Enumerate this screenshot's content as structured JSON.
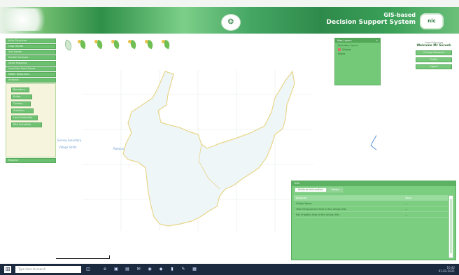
{
  "banner": {
    "title_line1": "GIS-based",
    "title_line2": "Decision Support System",
    "nic_logo": "nic"
  },
  "sidebar": {
    "items": [
      "Infra Structure",
      "Crop Health",
      "Soil Health",
      "Spatial Analysis",
      "Asset Mapping",
      "Land Use Land Cover",
      "Water Resources",
      "Weather",
      "Reports"
    ],
    "active_group": "Analysis",
    "subitems": [
      "Boundary",
      "Buffer",
      "Overlay",
      "Statistics",
      "Land Suitability",
      "Site Suitability"
    ]
  },
  "tools": [
    "leaf-icon",
    "leaf-icon",
    "leaf-icon",
    "leaf-icon",
    "leaf-icon",
    "leaf-icon",
    "leaf-icon"
  ],
  "map": {
    "label_left": "Survey boundary",
    "label_left2": "Village limits",
    "label_center": "Rampur",
    "accent": "#e8d68a",
    "fill": "#eef6f8"
  },
  "legend": {
    "title": "Map Layers",
    "row1": "Boundary Layers",
    "row2": "Villages",
    "row3": "Roads"
  },
  "user": {
    "greeting": "Good Morning",
    "name": "Welcome Mr Suresh",
    "btn1": "Change Password",
    "btn2": "Profile",
    "btn3": "Logout"
  },
  "attribute": {
    "title": "Info",
    "tab_active": "Attribute Information",
    "tab_other": "Details",
    "columns": [
      "Attribute",
      "Value"
    ],
    "rows": [
      [
        "Village Name",
        "—"
      ],
      [
        "Total Geographical Area of the village (Ha)",
        "—"
      ],
      [
        "Net Irrigated Area of the village (Ha)",
        "—"
      ]
    ]
  },
  "taskbar": {
    "search_placeholder": "Type here to search",
    "time": "10:42",
    "date": "01-02-2021"
  }
}
